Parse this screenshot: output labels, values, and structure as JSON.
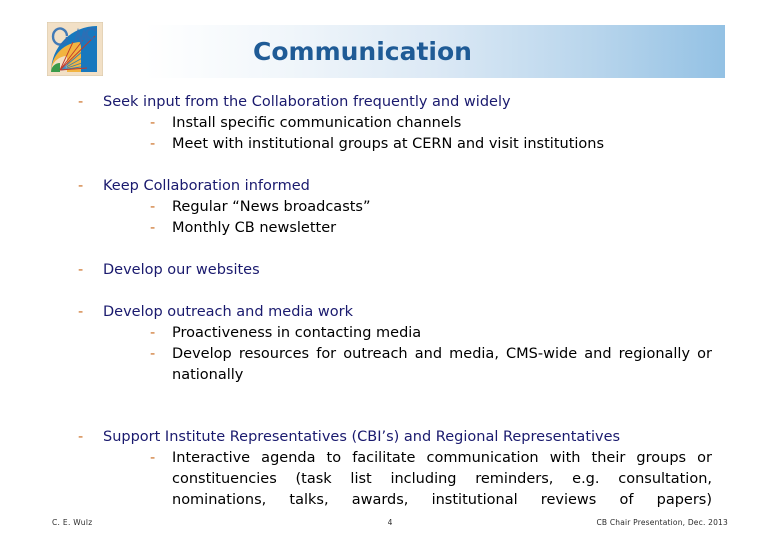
{
  "header": {
    "title": "Communication",
    "logo_name": "cms-detector-logo",
    "bar_gradient_from": "#ffffff",
    "bar_gradient_to": "#93c1e4",
    "title_color": "#1f5b96"
  },
  "theme": {
    "level1_text_color": "#1a1a6e",
    "level2_text_color": "#000000",
    "bullet_dash_color": "#c96a1d",
    "background": "#ffffff"
  },
  "content": {
    "bullet_glyph": "-",
    "blocks": [
      {
        "heading": "Seek input from the Collaboration frequently and widely",
        "sub": [
          "Install specific communication channels",
          "Meet with institutional groups at CERN and visit institutions"
        ]
      },
      {
        "heading": "Keep Collaboration informed",
        "sub": [
          "Regular “News broadcasts”",
          "Monthly CB newsletter"
        ]
      },
      {
        "heading": "Develop our websites",
        "sub": []
      },
      {
        "heading": "Develop outreach and media work",
        "sub": [
          "Proactiveness in contacting media",
          "Develop resources for outreach and media, CMS-wide and regionally or nationally"
        ]
      },
      {
        "heading": "Support Institute Representatives (CBI’s) and Regional Representatives",
        "sub": [
          "Interactive agenda to facilitate communication with their groups or constituencies (task list including reminders, e.g. consultation, nominations, talks, awards, institutional reviews of papers)"
        ]
      }
    ]
  },
  "footer": {
    "author": "C. E. Wulz",
    "page_number": "4",
    "presentation": "CB Chair Presentation, Dec. 2013"
  }
}
